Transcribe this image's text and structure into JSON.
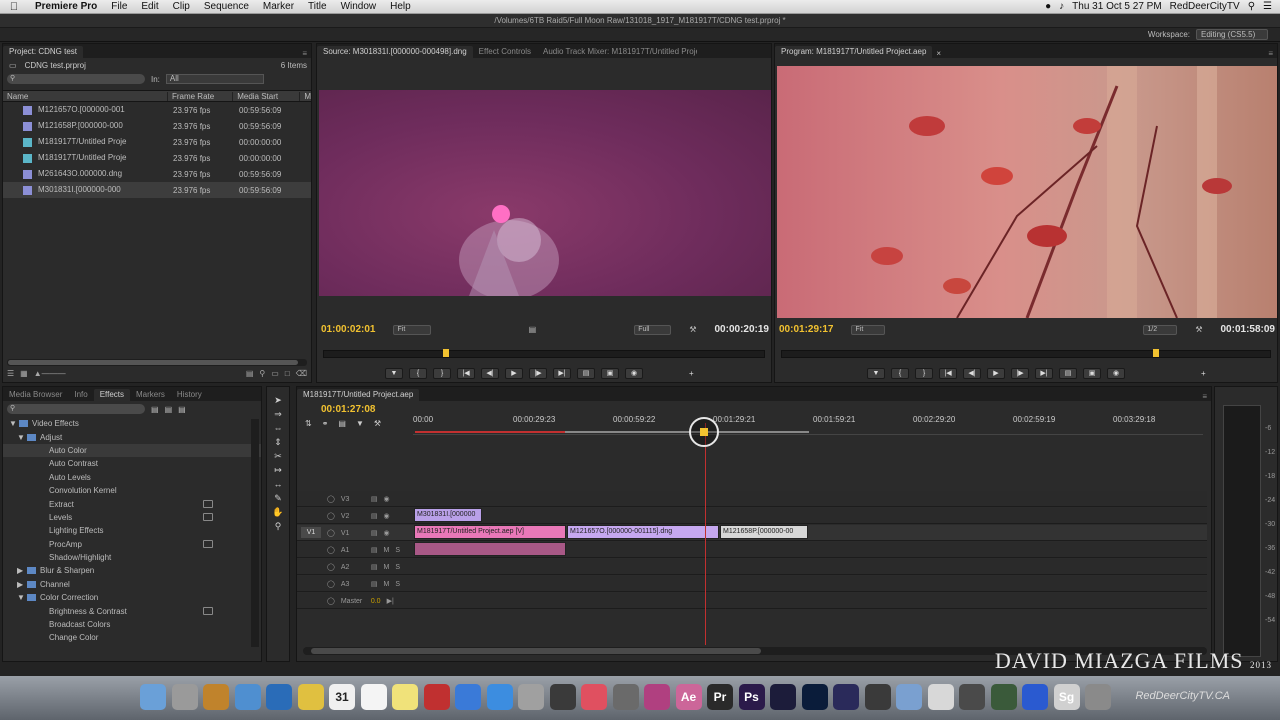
{
  "menubar": {
    "app_name": "Premiere Pro",
    "items": [
      "File",
      "Edit",
      "Clip",
      "Sequence",
      "Marker",
      "Title",
      "Window",
      "Help"
    ],
    "clock": "Thu 31 Oct  5 27 PM",
    "user": "RedDeerCityTV"
  },
  "window": {
    "title": "/Volumes/6TB Raid5/Full Moon Raw/131018_1917_M181917T/CDNG test.prproj *"
  },
  "workspace": {
    "label": "Workspace:",
    "value": "Editing (CS5.5)"
  },
  "project": {
    "tab": "Project: CDNG test",
    "file": "CDNG test.prproj",
    "count": "6 Items",
    "in_label": "In:",
    "in_value": "All",
    "columns": [
      "Name",
      "Frame Rate",
      "Media Start",
      "M"
    ],
    "items": [
      {
        "name": "M121657O.[000000-001",
        "rate": "23.976 fps",
        "start": "00:59:56:09",
        "kind": "clip"
      },
      {
        "name": "M121658P.[000000-000",
        "rate": "23.976 fps",
        "start": "00:59:56:09",
        "kind": "clip"
      },
      {
        "name": "M181917T/Untitled Proje",
        "rate": "23.976 fps",
        "start": "00:00:00:00",
        "kind": "seq"
      },
      {
        "name": "M181917T/Untitled Proje",
        "rate": "23.976 fps",
        "start": "00:00:00:00",
        "kind": "seq"
      },
      {
        "name": "M261643O.000000.dng",
        "rate": "23.976 fps",
        "start": "00:59:56:09",
        "kind": "clip"
      },
      {
        "name": "M301831I.[000000-000",
        "rate": "23.976 fps",
        "start": "00:59:56:09",
        "kind": "clip"
      }
    ]
  },
  "source": {
    "tabs": [
      "Source: M301831I.[000000-000498].dng",
      "Effect Controls",
      "Audio Track Mixer: M181917T/Untitled Proje"
    ],
    "timecode": "01:00:02:01",
    "fit": "Fit",
    "quality": "Full",
    "duration": "00:00:20:19",
    "playhead": 0.27
  },
  "program": {
    "tab": "Program: M181917T/Untitled Project.aep",
    "timecode": "00:01:29:17",
    "fit": "Fit",
    "quality": "1/2",
    "duration": "00:01:58:09",
    "playhead": 0.76
  },
  "effects": {
    "tabs": [
      "Media Browser",
      "Info",
      "Effects",
      "Markers",
      "History"
    ],
    "tree": [
      {
        "label": "Video Effects",
        "level": 0,
        "open": true
      },
      {
        "label": "Adjust",
        "level": 1,
        "open": true
      },
      {
        "label": "Auto Color",
        "level": 2,
        "badge": false
      },
      {
        "label": "Auto Contrast",
        "level": 2,
        "badge": false
      },
      {
        "label": "Auto Levels",
        "level": 2,
        "badge": false
      },
      {
        "label": "Convolution Kernel",
        "level": 2,
        "badge": false
      },
      {
        "label": "Extract",
        "level": 2,
        "badge": true
      },
      {
        "label": "Levels",
        "level": 2,
        "badge": true
      },
      {
        "label": "Lighting Effects",
        "level": 2,
        "badge": false
      },
      {
        "label": "ProcAmp",
        "level": 2,
        "badge": true
      },
      {
        "label": "Shadow/Highlight",
        "level": 2,
        "badge": false
      },
      {
        "label": "Blur & Sharpen",
        "level": 1,
        "open": false
      },
      {
        "label": "Channel",
        "level": 1,
        "open": false
      },
      {
        "label": "Color Correction",
        "level": 1,
        "open": true
      },
      {
        "label": "Brightness & Contrast",
        "level": 2,
        "badge": true
      },
      {
        "label": "Broadcast Colors",
        "level": 2,
        "badge": false
      },
      {
        "label": "Change Color",
        "level": 2,
        "badge": false
      }
    ]
  },
  "timeline": {
    "tab": "M181917T/Untitled Project.aep",
    "timecode": "00:01:27:08",
    "ruler": [
      "00:00",
      "00:00:29:23",
      "00:00:59:22",
      "00:01:29:21",
      "00:01:59:21",
      "00:02:29:20",
      "00:02:59:19",
      "00:03:29:18"
    ],
    "tracks": [
      {
        "name": "V3",
        "type": "video"
      },
      {
        "name": "V2",
        "type": "video"
      },
      {
        "name": "V1",
        "type": "video",
        "src": "V1"
      },
      {
        "name": "A1",
        "type": "audio"
      },
      {
        "name": "A2",
        "type": "audio"
      },
      {
        "name": "A3",
        "type": "audio"
      },
      {
        "name": "Master",
        "type": "master",
        "level": "0.0"
      }
    ],
    "clips": {
      "v2": "M301831I.[000000",
      "v1a": "M181917T/Untitled Project.aep [V]",
      "v1b": "M121657O.[000000-001115].dng",
      "v1c": "M121658P.[000000-00"
    }
  },
  "meter": {
    "db": [
      "-6",
      "-12",
      "-18",
      "-24",
      "-30",
      "-36",
      "-42",
      "-48",
      "-54"
    ]
  },
  "watermark": {
    "brand": "DAVID MIAZGA FILMS",
    "year": "2013",
    "site": "RedDeerCityTV.CA"
  },
  "dock": {
    "labels": [
      "Ae",
      "Pr",
      "Ps",
      "Sg"
    ],
    "calendar_day": "31"
  }
}
